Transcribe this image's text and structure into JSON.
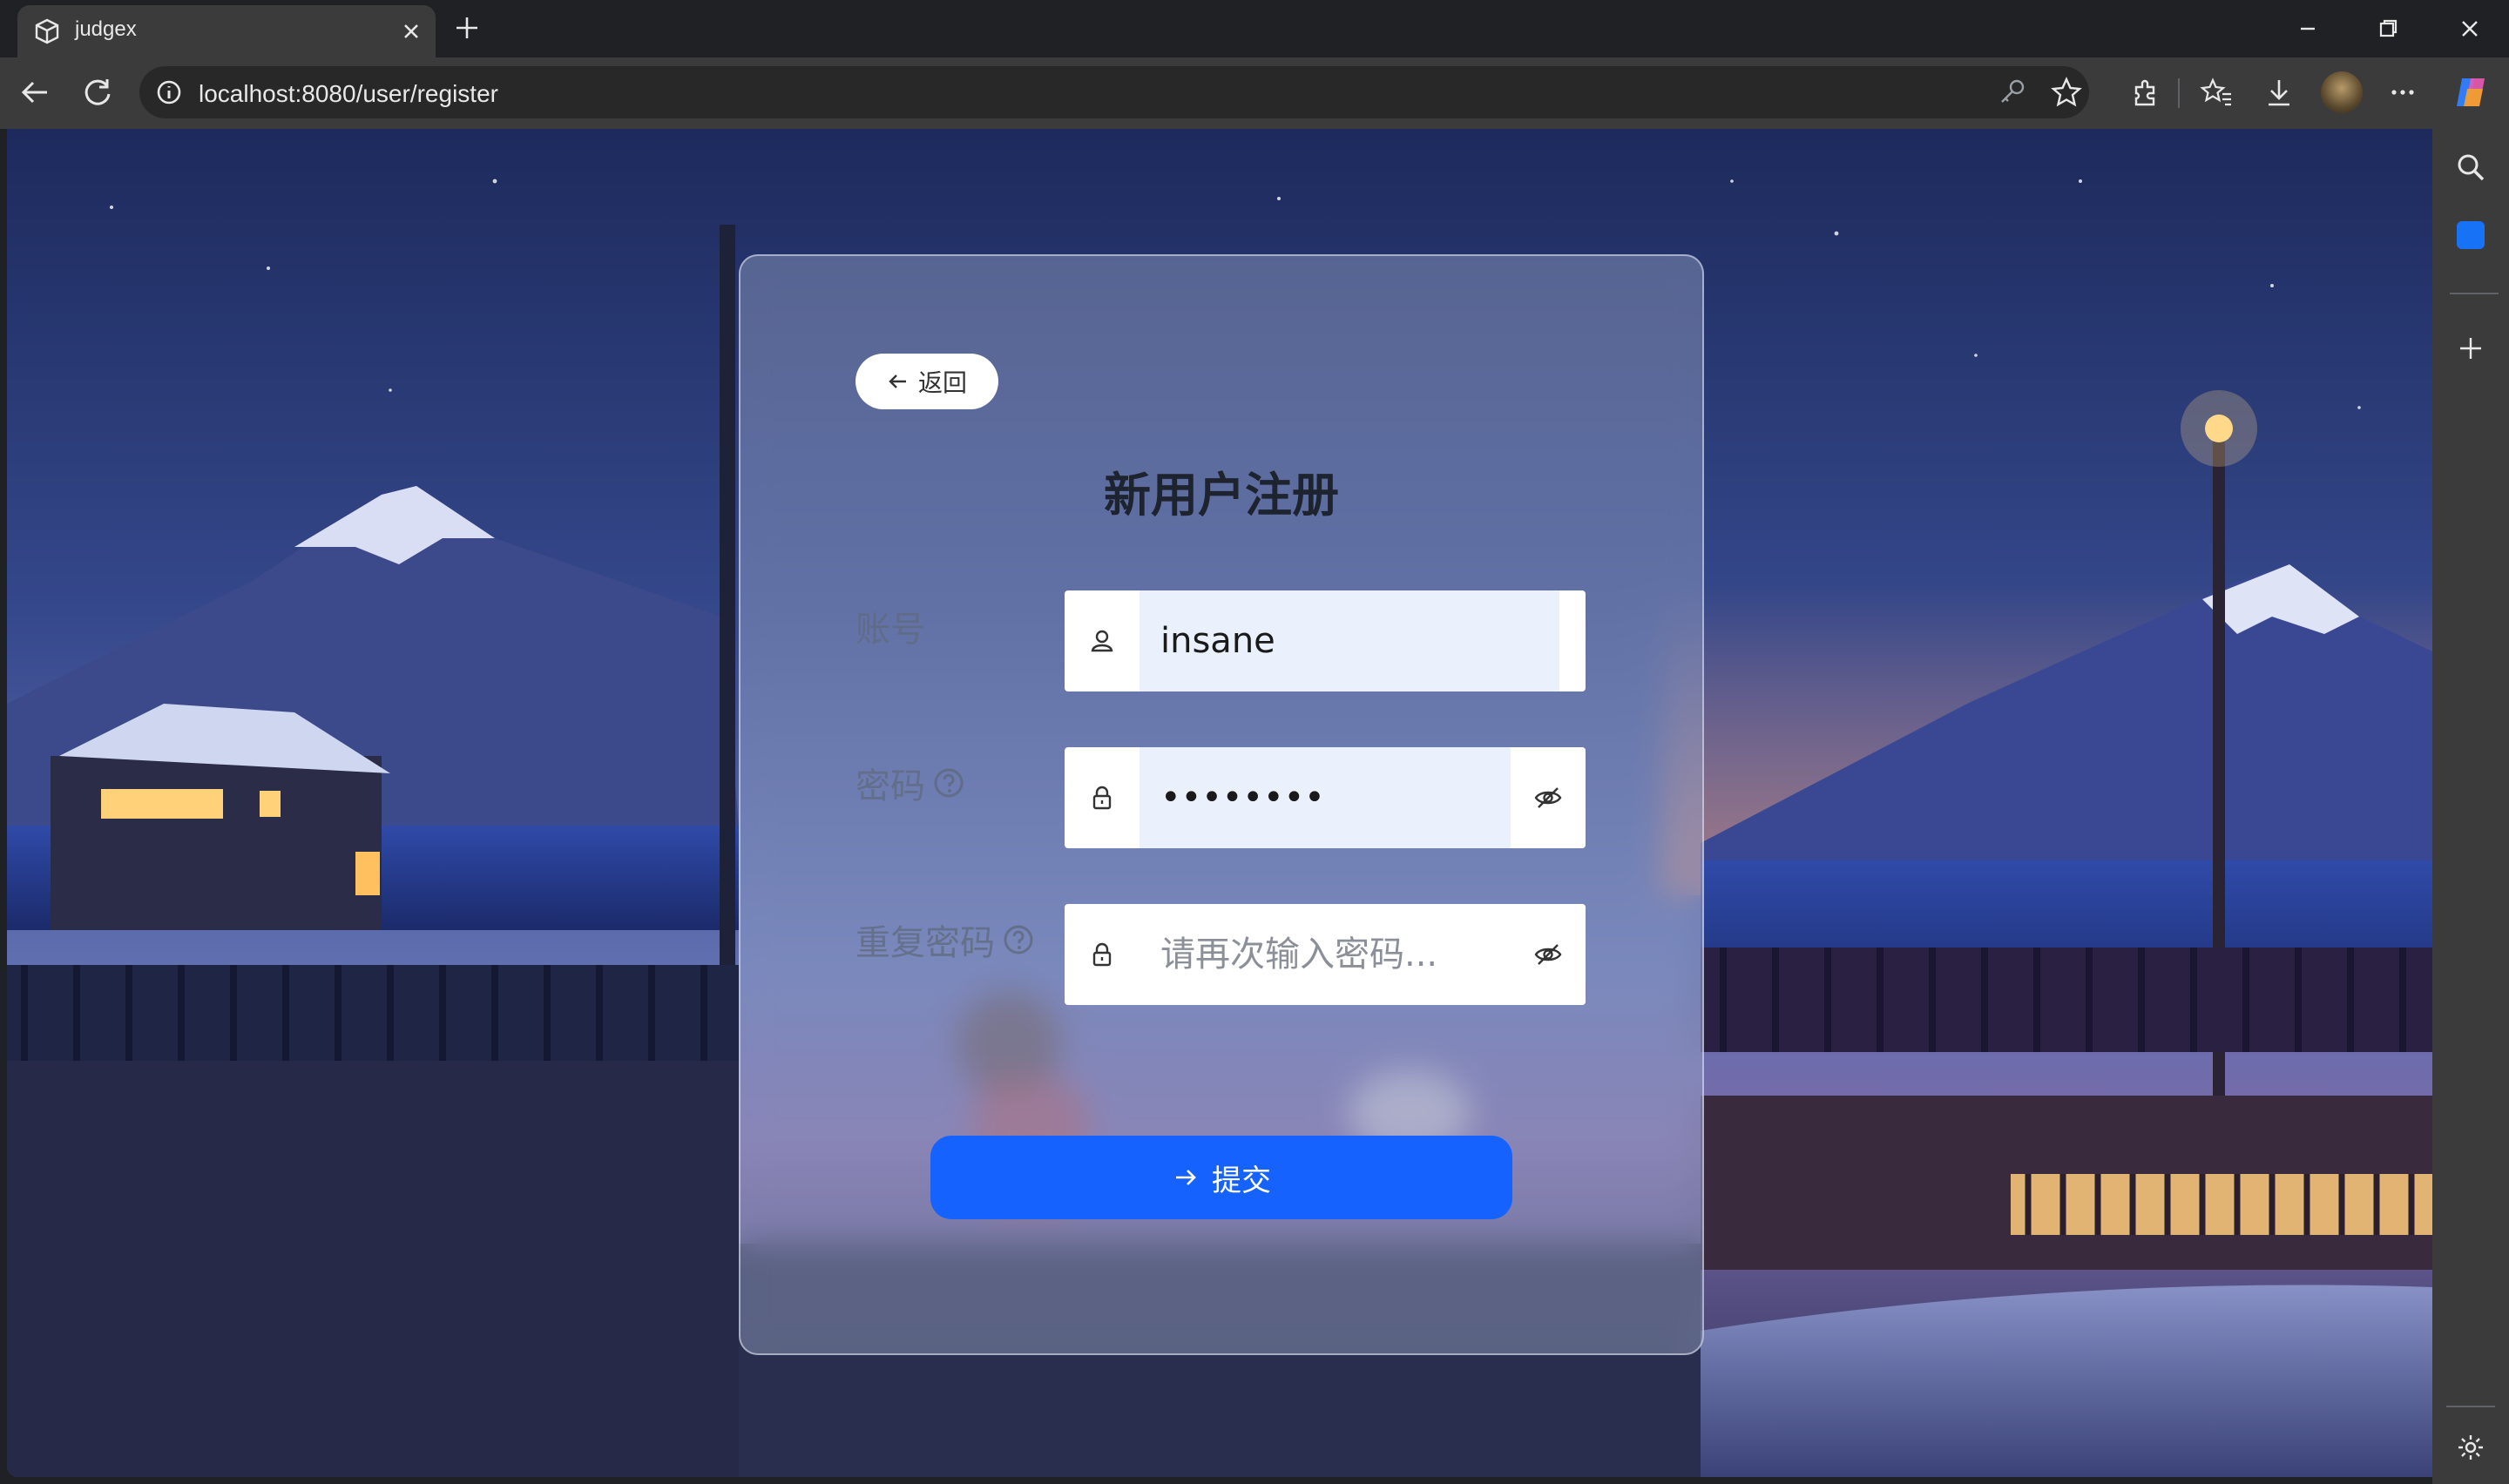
{
  "browser": {
    "tab_title": "judgex",
    "url": "localhost:8080/user/register"
  },
  "page": {
    "back_label": "返回",
    "title": "新用户注册",
    "fields": {
      "account": {
        "label": "账号",
        "value": "insane"
      },
      "password": {
        "label": "密码",
        "value": "••••••••"
      },
      "confirm": {
        "label": "重复密码",
        "placeholder": "请再次输入密码..."
      }
    },
    "submit_label": "提交"
  },
  "colors": {
    "primary": "#1662ff",
    "input_fill": "#eaf0fc"
  }
}
